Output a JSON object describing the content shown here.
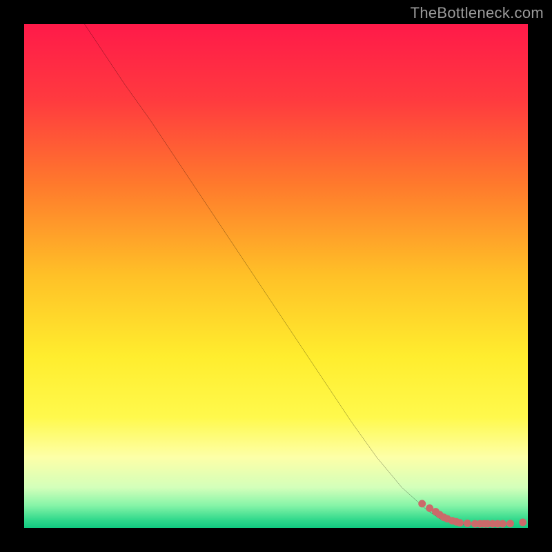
{
  "watermark": "TheBottleneck.com",
  "chart_data": {
    "type": "line",
    "title": "",
    "xlabel": "",
    "ylabel": "",
    "xlim": [
      0,
      100
    ],
    "ylim": [
      0,
      100
    ],
    "grid": false,
    "legend": false,
    "gradient_stops": [
      {
        "offset": 0.0,
        "color": "#ff1a49"
      },
      {
        "offset": 0.15,
        "color": "#ff3a3f"
      },
      {
        "offset": 0.32,
        "color": "#ff7a2c"
      },
      {
        "offset": 0.5,
        "color": "#ffc127"
      },
      {
        "offset": 0.66,
        "color": "#ffed2e"
      },
      {
        "offset": 0.78,
        "color": "#fff94c"
      },
      {
        "offset": 0.86,
        "color": "#fdffa8"
      },
      {
        "offset": 0.92,
        "color": "#d3ffba"
      },
      {
        "offset": 0.955,
        "color": "#87f5a8"
      },
      {
        "offset": 0.985,
        "color": "#2fd88b"
      },
      {
        "offset": 1.0,
        "color": "#11c981"
      }
    ],
    "series": [
      {
        "name": "curve",
        "color": "#000000",
        "x": [
          12,
          16,
          20,
          25,
          30,
          35,
          40,
          45,
          50,
          55,
          60,
          65,
          70,
          75,
          80,
          83,
          86,
          88
        ],
        "y": [
          100,
          94,
          88,
          81,
          73.5,
          66,
          58.5,
          51,
          43.5,
          36,
          28.5,
          21,
          14,
          8,
          3.5,
          1.5,
          0.8,
          0.6
        ]
      },
      {
        "name": "markers",
        "color": "#cb6a6a",
        "x": [
          79,
          80.5,
          81.7,
          82.5,
          83.3,
          84,
          85,
          85.8,
          86.5,
          88,
          89.5,
          90.5,
          91.3,
          92,
          93,
          94,
          95,
          96.5,
          99
        ],
        "y": [
          4.8,
          3.9,
          3.2,
          2.6,
          2.1,
          1.8,
          1.4,
          1.2,
          1.0,
          0.9,
          0.8,
          0.8,
          0.8,
          0.8,
          0.8,
          0.8,
          0.8,
          0.85,
          1.1
        ]
      }
    ]
  }
}
